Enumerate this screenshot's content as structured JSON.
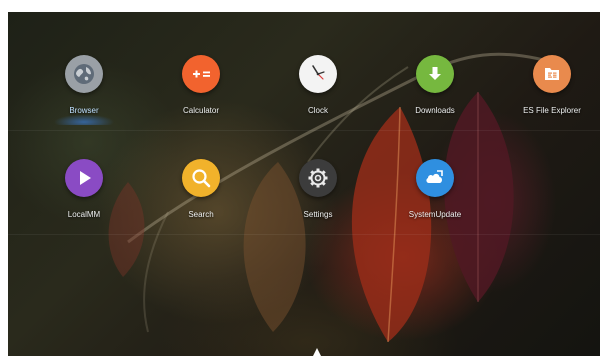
{
  "launcher": {
    "row1": [
      {
        "label": "Browser",
        "icon": "browser-globe-icon",
        "color": "#9aa0a6"
      },
      {
        "label": "Calculator",
        "icon": "calculator-icon",
        "color": "#f2632e"
      },
      {
        "label": "Clock",
        "icon": "clock-icon",
        "color": "#f3f3f3"
      },
      {
        "label": "Downloads",
        "icon": "download-arrow-icon",
        "color": "#76b83f"
      },
      {
        "label": "ES File Explorer",
        "icon": "es-file-explorer-icon",
        "color": "#e98a4d"
      }
    ],
    "row2": [
      {
        "label": "LocalMM",
        "icon": "play-icon",
        "color": "#8a4bc4"
      },
      {
        "label": "Search",
        "icon": "search-icon",
        "color": "#f1b22b"
      },
      {
        "label": "Settings",
        "icon": "gear-icon",
        "color": "#3c3c3c"
      },
      {
        "label": "SystemUpdate",
        "icon": "cloud-update-icon",
        "color": "#2f8fe0"
      }
    ],
    "selected": "Browser"
  }
}
